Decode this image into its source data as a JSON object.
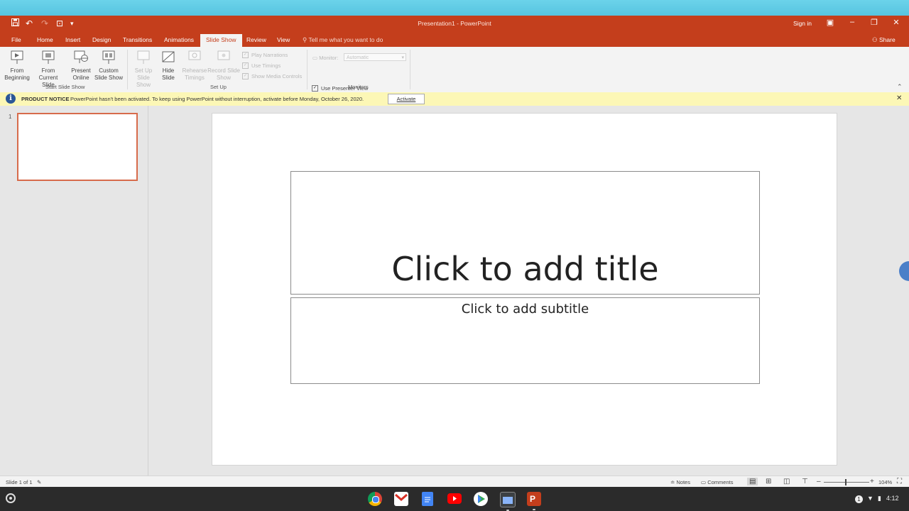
{
  "window": {
    "title": "Presentation1 - PowerPoint",
    "sign_in": "Sign in",
    "share": "Share"
  },
  "tabs": [
    {
      "label": "File"
    },
    {
      "label": "Home"
    },
    {
      "label": "Insert"
    },
    {
      "label": "Design"
    },
    {
      "label": "Transitions"
    },
    {
      "label": "Animations"
    },
    {
      "label": "Slide Show",
      "active": true
    },
    {
      "label": "Review"
    },
    {
      "label": "View"
    }
  ],
  "tell_me": "Tell me what you want to do",
  "ribbon": {
    "start_group": {
      "label": "Start Slide Show",
      "from_beginning": "From Beginning",
      "from_current": "From Current Slide",
      "present_online": "Present Online",
      "custom_show": "Custom Slide Show"
    },
    "setup_group": {
      "label": "Set Up",
      "setup_show": "Set Up Slide Show",
      "hide_slide": "Hide Slide",
      "rehearse": "Rehearse Timings",
      "record": "Record Slide Show",
      "play_narrations": "Play Narrations",
      "use_timings": "Use Timings",
      "show_media": "Show Media Controls"
    },
    "monitors_group": {
      "label": "Monitors",
      "monitor_label": "Monitor:",
      "monitor_value": "Automatic",
      "presenter_view": "Use Presenter View"
    }
  },
  "notice": {
    "heading": "PRODUCT NOTICE",
    "message": "PowerPoint hasn't been activated. To keep using PowerPoint without interruption, activate before Monday, October 26, 2020.",
    "activate": "Activate"
  },
  "thumbnails": [
    {
      "number": "1"
    }
  ],
  "slide": {
    "title_placeholder": "Click to add title",
    "subtitle_placeholder": "Click to add subtitle"
  },
  "status": {
    "slide_count": "Slide 1 of 1",
    "notes": "Notes",
    "comments": "Comments",
    "zoom": "104%"
  },
  "tray": {
    "notification_count": "1",
    "time": "4:12"
  },
  "colors": {
    "accent": "#c43e1c",
    "notice_bg": "#fcf7b6"
  }
}
